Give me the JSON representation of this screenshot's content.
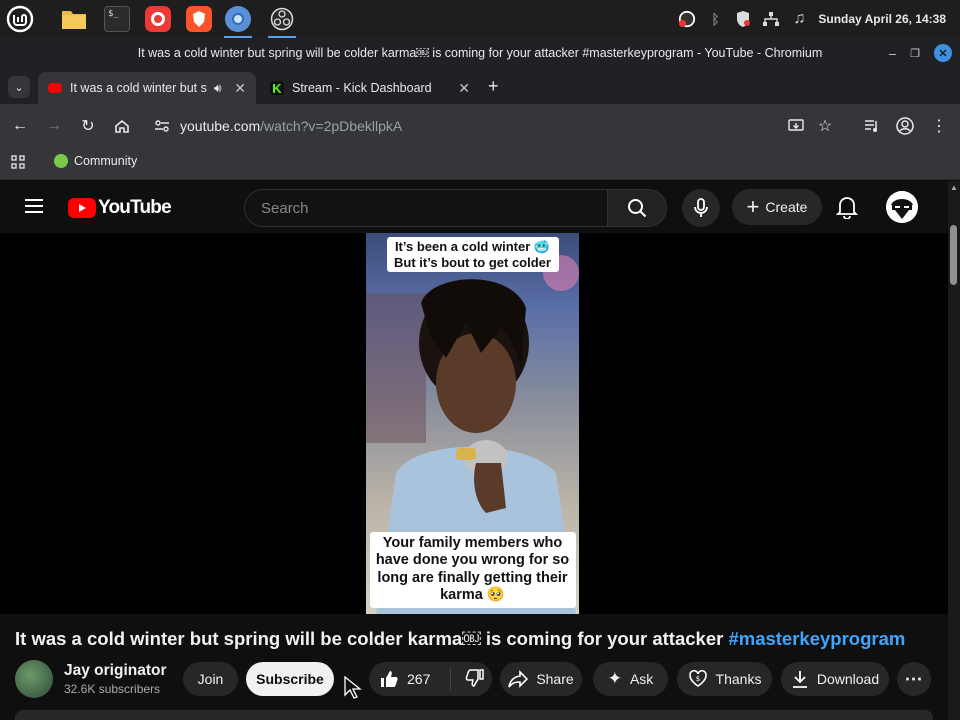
{
  "taskbar": {
    "apps": [
      "Mint menu",
      "Files",
      "Terminal",
      "Vivaldi",
      "Brave",
      "Chromium",
      "OBS"
    ],
    "clock": "Sunday April 26, 14:38"
  },
  "window": {
    "title": "It was a cold winter but spring will be colder karma￼ is coming for your attacker #masterkeyprogram - YouTube - Chromium"
  },
  "tabs": [
    {
      "label": "It was a cold winter but s",
      "active": true,
      "audio": true
    },
    {
      "label": "Stream - Kick Dashboard",
      "active": false
    }
  ],
  "toolbar": {
    "url_host": "youtube.com",
    "url_path": "/watch?v=2pDbekllpkA"
  },
  "bookmarks": [
    {
      "label": "Community"
    }
  ],
  "youtube": {
    "logo_text": "YouTube",
    "search_placeholder": "Search",
    "create_label": "Create"
  },
  "video": {
    "caption_top": "It’s been a cold winter 🥶 But it’s bout to get colder",
    "caption_bottom": "Your family members who have done you wrong for so long are finally getting their karma 🥺",
    "title_main": "It was a cold winter but spring will be colder karma￼ is coming for your attacker ",
    "title_tag": "#masterkeyprogram"
  },
  "channel": {
    "name": "Jay originator",
    "subscribers": "32.6K subscribers",
    "join_label": "Join",
    "subscribe_label": "Subscribe"
  },
  "actions": {
    "likes": "267",
    "share": "Share",
    "ask": "Ask",
    "thanks": "Thanks",
    "download": "Download"
  },
  "colors": {
    "accent": "#3ea6ff",
    "youtube_red": "#ff0000",
    "background": "#0f0f0f"
  }
}
